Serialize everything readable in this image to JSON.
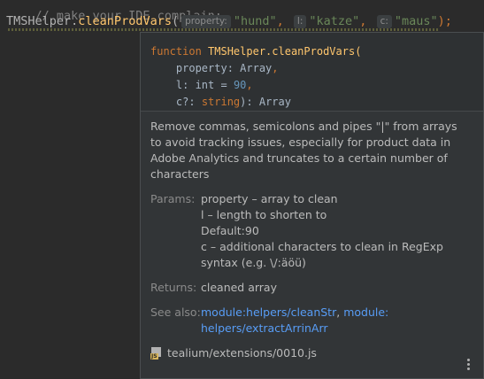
{
  "editor": {
    "comment": "// make your IDE complain:",
    "call": {
      "object": "TMSHelper",
      "dot": ".",
      "method": "cleanProdVars",
      "open": "(",
      "args": [
        {
          "hint": "property:",
          "value": "\"hund\"",
          "sep": ","
        },
        {
          "hint": "l:",
          "value": "\"katze\"",
          "sep": ","
        },
        {
          "hint": "c:",
          "value": "\"maus\"",
          "sep": ");"
        }
      ]
    }
  },
  "popup": {
    "signature": {
      "keyword": "function",
      "name": "TMSHelper.cleanProdVars(",
      "p1_name": "property: ",
      "p1_type": "Array",
      "p1_comma": ",",
      "p2_name": "l: int = ",
      "p2_default": "90",
      "p2_comma": ",",
      "p3_name": "c?: ",
      "p3_type": "string",
      "tail": "): Array"
    },
    "description": "Remove commas, semicolons and pipes \"|\" from arrays to avoid tracking issues, especially for product data in Adobe Analytics and truncates to a certain number of characters",
    "params_label": "Params:",
    "params": [
      "property – array to clean",
      "l – length to shorten to",
      "Default:90",
      "c – additional characters to clean in RegExp syntax (e.g. \\/:äöü)"
    ],
    "returns_label": "Returns:",
    "returns": "cleaned array",
    "see_also_label": "See also:",
    "see_also": [
      {
        "text": "module:helpers/cleanStr",
        "sep": ", "
      },
      {
        "text": "module:",
        "sep": ""
      }
    ],
    "see_also_line2": "helpers/extractArrinArr",
    "file_icon": "js-file-icon",
    "file_tag": "JS",
    "file": "tealium/extensions/0010.js",
    "menu_icon": "more-vertical-icon"
  }
}
